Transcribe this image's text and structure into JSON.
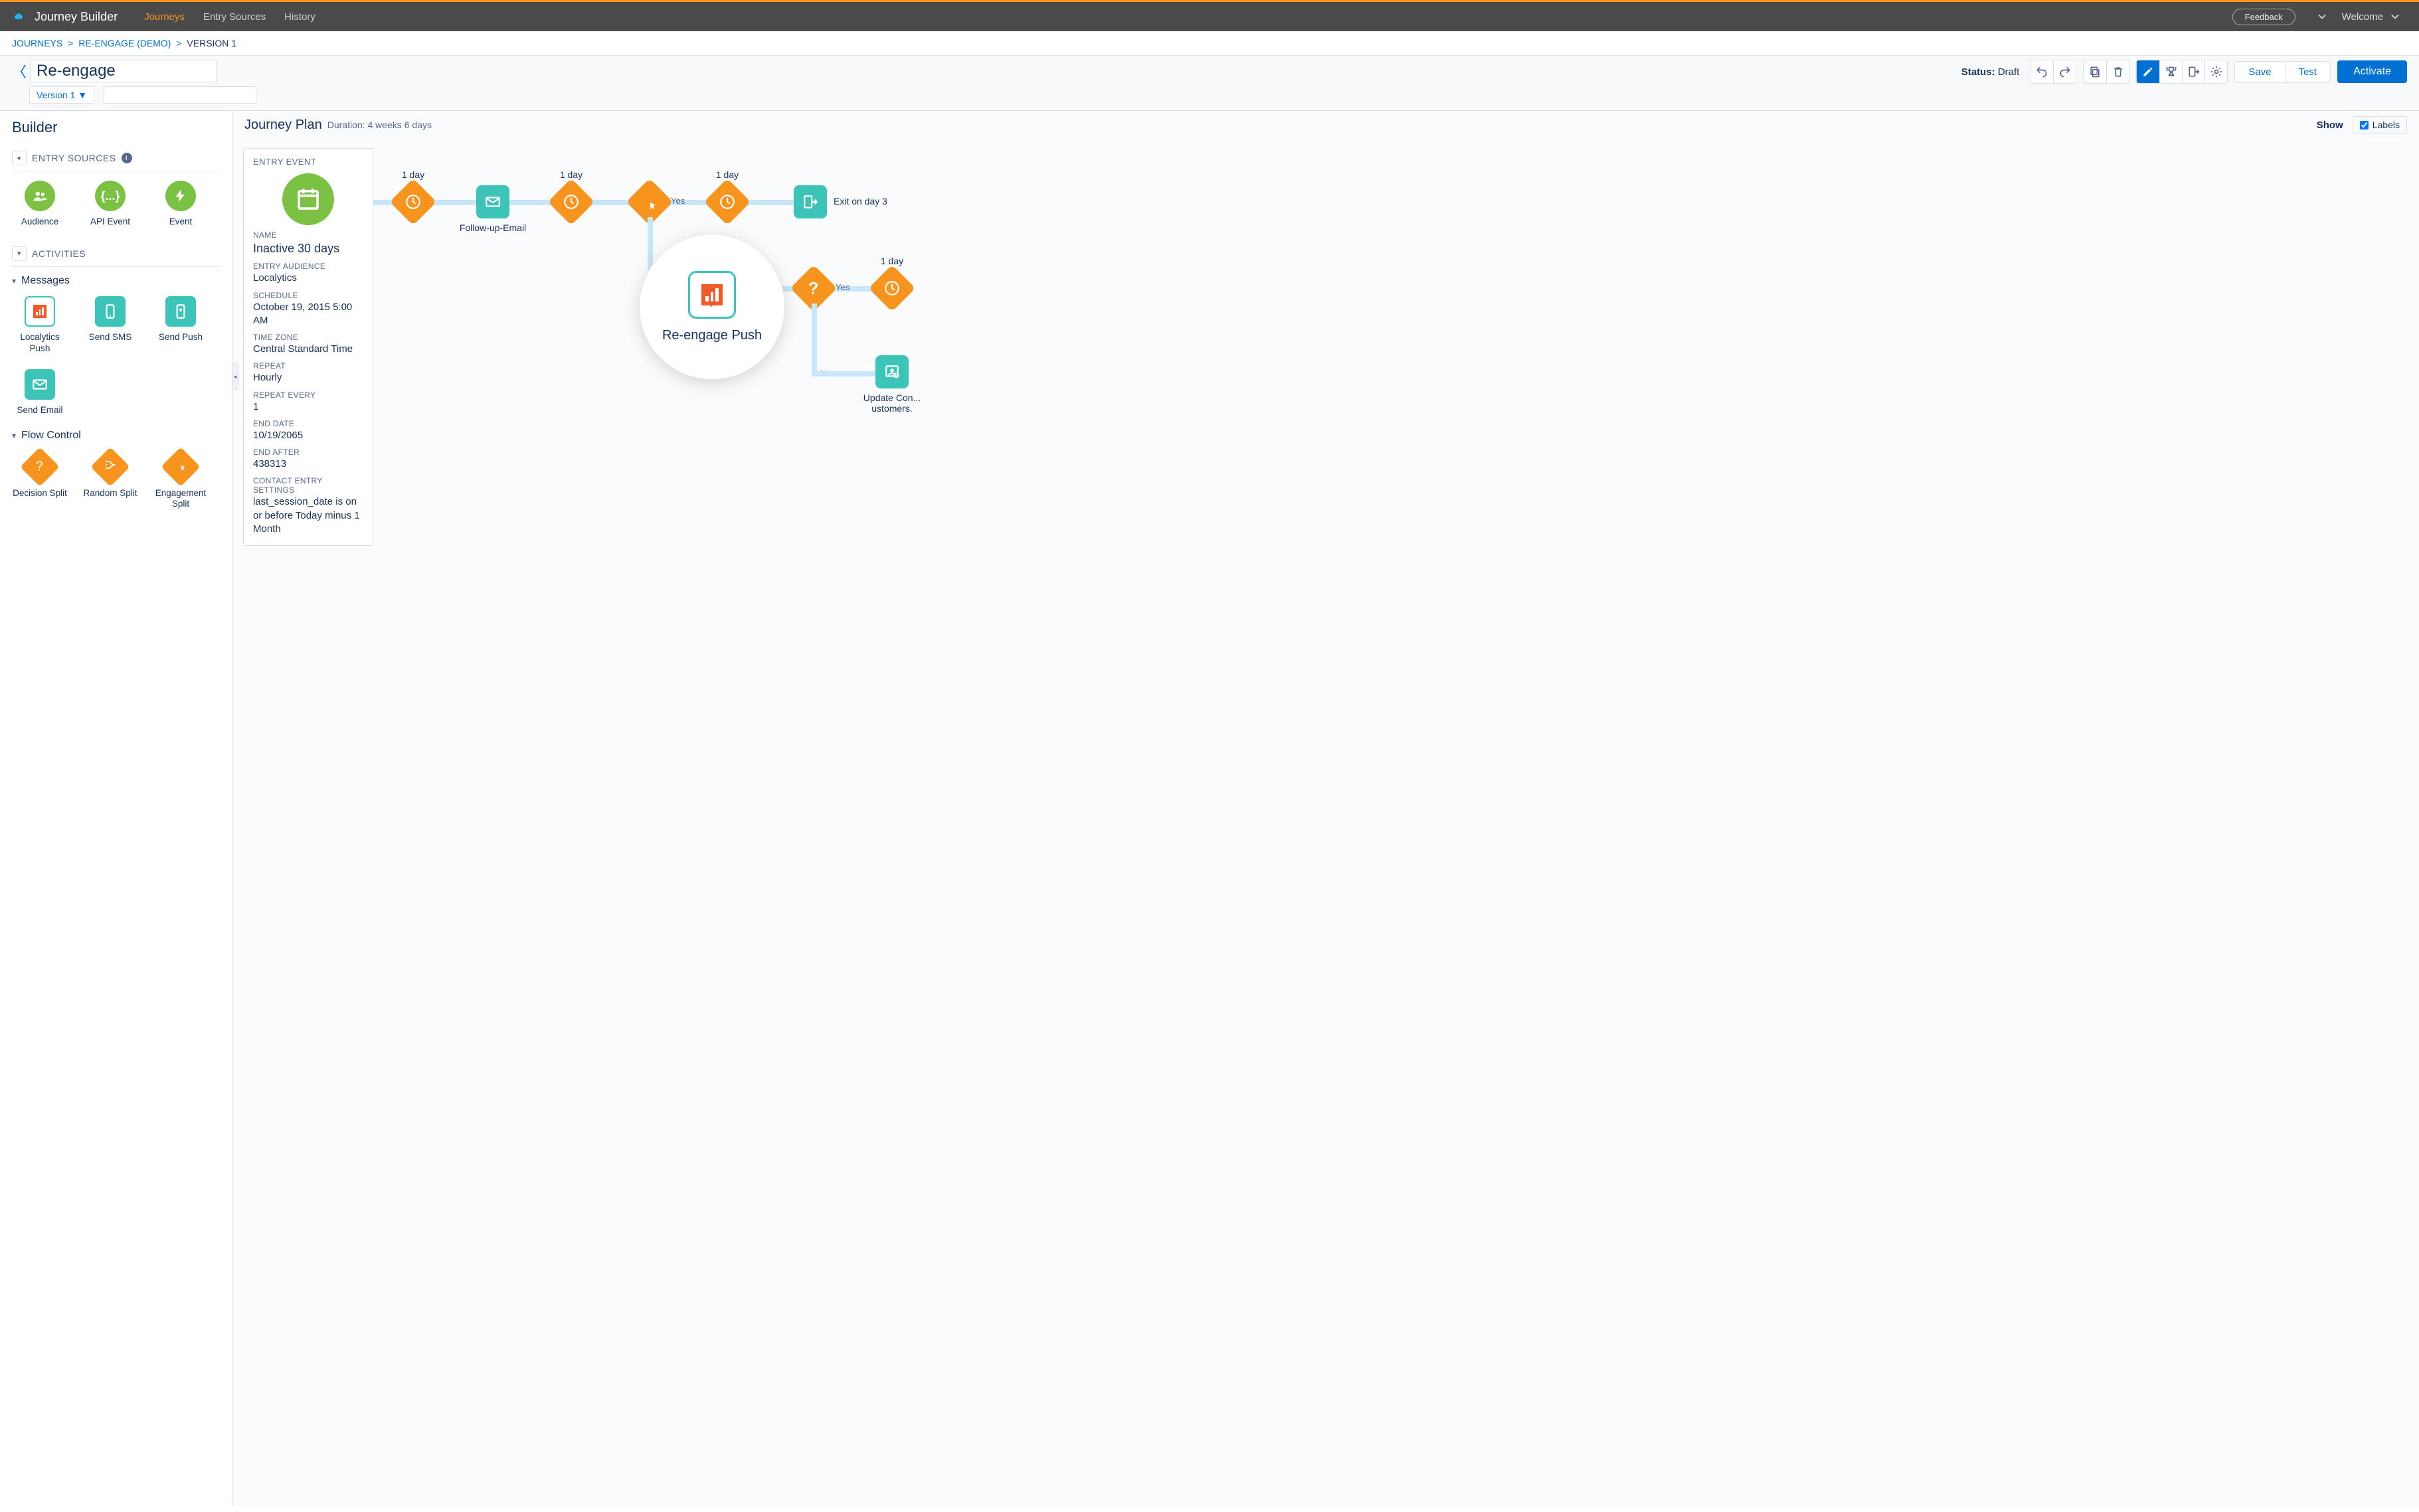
{
  "header": {
    "app": "Journey Builder",
    "nav": [
      "Journeys",
      "Entry Sources",
      "History"
    ],
    "active_nav_index": 0,
    "feedback": "Feedback",
    "welcome": "Welcome"
  },
  "breadcrumb": {
    "items": [
      "JOURNEYS",
      "RE-ENGAGE (DEMO)"
    ],
    "current": "VERSION 1"
  },
  "title_bar": {
    "journey_name": "Re-engage",
    "version_label": "Version 1 ▼",
    "status_label": "Status:",
    "status_value": "Draft",
    "save": "Save",
    "test": "Test",
    "activate": "Activate"
  },
  "sidebar": {
    "title": "Builder",
    "section_entry_sources": "ENTRY SOURCES",
    "section_activities": "ACTIVITIES",
    "entry_tiles": [
      {
        "label": "Audience",
        "icon": "audience"
      },
      {
        "label": "API Event",
        "icon": "api"
      },
      {
        "label": "Event",
        "icon": "event"
      }
    ],
    "sub_messages": "Messages",
    "messages_tiles": [
      {
        "label": "Localytics Push",
        "icon": "localytics"
      },
      {
        "label": "Send SMS",
        "icon": "send-sms"
      },
      {
        "label": "Send Push",
        "icon": "send-push"
      },
      {
        "label": "Send Email",
        "icon": "send-email"
      }
    ],
    "sub_flow": "Flow Control",
    "flow_tiles": [
      {
        "label": "Decision Split",
        "icon": "decision"
      },
      {
        "label": "Random Split",
        "icon": "random"
      },
      {
        "label": "Engagement Split",
        "icon": "engagement"
      }
    ]
  },
  "canvas_header": {
    "title": "Journey Plan",
    "duration_label": "Duration:",
    "duration_value": "4 weeks 6 days",
    "show": "Show",
    "labels_check": "Labels"
  },
  "entry_card": {
    "heading": "ENTRY EVENT",
    "fields": [
      {
        "label": "NAME",
        "value": "Inactive 30 days"
      },
      {
        "label": "ENTRY AUDIENCE",
        "value": "Localytics"
      },
      {
        "label": "SCHEDULE",
        "value": "October 19, 2015 5:00 AM"
      },
      {
        "label": "TIME ZONE",
        "value": "Central Standard Time"
      },
      {
        "label": "REPEAT",
        "value": "Hourly"
      },
      {
        "label": "REPEAT EVERY",
        "value": "1"
      },
      {
        "label": "END DATE",
        "value": "10/19/2065"
      },
      {
        "label": "END AFTER",
        "value": "438313"
      },
      {
        "label": "CONTACT ENTRY SETTINGS",
        "value": "last_session_date is on or before Today minus 1 Month"
      }
    ]
  },
  "canvas": {
    "wait_label": "1 day",
    "followup_email": "Follow-up-Email",
    "yes": "Yes",
    "no": "No",
    "exit_label": "Exit on day 3",
    "reengage_push": "Re-engage Push",
    "update_contact": "Update Con... ustomers."
  },
  "colors": {
    "accent_orange": "#f7941e",
    "teal": "#3cc4b8",
    "green": "#7bc143",
    "blue": "#0070d2",
    "edge": "#c7e6f9",
    "localytics": "#f15a29"
  }
}
